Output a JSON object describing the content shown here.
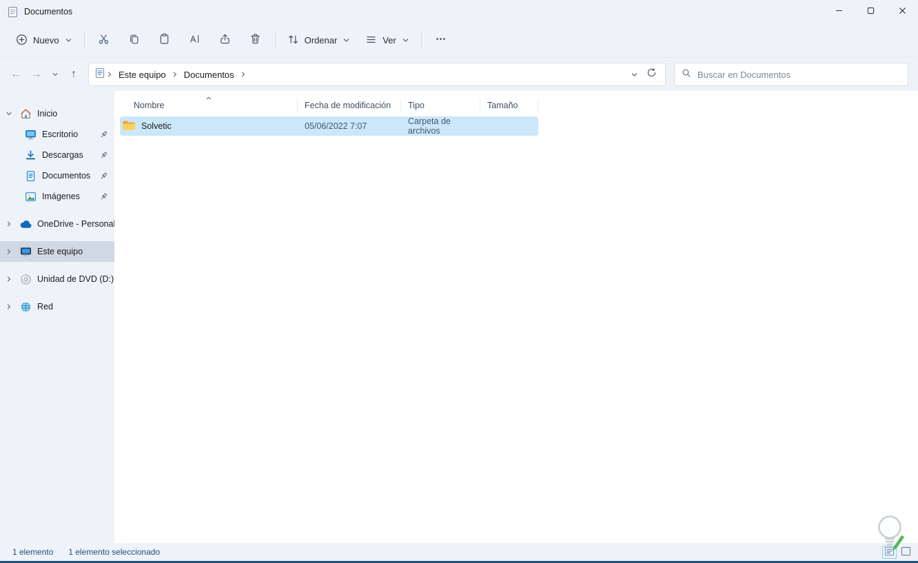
{
  "window": {
    "title": "Documentos"
  },
  "toolbar": {
    "new_label": "Nuevo",
    "sort_label": "Ordenar",
    "view_label": "Ver"
  },
  "navbar": {
    "breadcrumb": [
      "Este equipo",
      "Documentos"
    ],
    "search_placeholder": "Buscar en Documentos"
  },
  "icons": {
    "back": "←",
    "forward": "→",
    "up": "↑",
    "app": "document-icon",
    "new": "plus-circle-icon",
    "cut": "scissors-icon",
    "copy": "copy-icon",
    "paste": "clipboard-icon",
    "rename": "rename-icon",
    "share": "share-icon",
    "delete": "trash-icon",
    "sort": "sort-arrows-icon",
    "view": "list-lines-icon",
    "more": "ellipsis-icon",
    "refresh": "refresh-icon",
    "search": "magnifier-icon"
  },
  "sidebar": {
    "items": [
      {
        "label": "Inicio",
        "icon": "home-icon",
        "state": "expanded"
      },
      {
        "label": "Escritorio",
        "icon": "desktop-icon",
        "pinned": true
      },
      {
        "label": "Descargas",
        "icon": "downloads-icon",
        "pinned": true
      },
      {
        "label": "Documentos",
        "icon": "documents-icon",
        "pinned": true
      },
      {
        "label": "Imágenes",
        "icon": "pictures-icon",
        "pinned": true
      },
      {
        "label": "OneDrive - Personal",
        "icon": "onedrive-icon",
        "state": "collapsed"
      },
      {
        "label": "Este equipo",
        "icon": "computer-icon",
        "state": "collapsed",
        "selected": true
      },
      {
        "label": "Unidad de DVD (D:)",
        "icon": "dvd-icon",
        "state": "collapsed"
      },
      {
        "label": "Red",
        "icon": "network-icon",
        "state": "collapsed"
      }
    ]
  },
  "files": {
    "columns": [
      {
        "label": "Nombre",
        "sort": "ascending"
      },
      {
        "label": "Fecha de modificación"
      },
      {
        "label": "Tipo"
      },
      {
        "label": "Tamaño"
      }
    ],
    "rows": [
      {
        "name": "Solvetic",
        "icon": "folder-icon",
        "modified": "05/06/2022 7:07",
        "type": "Carpeta de archivos",
        "size": "",
        "selected": true
      }
    ]
  },
  "statusbar": {
    "items_count": "1 elemento",
    "selection_count": "1 elemento seleccionado"
  },
  "colors": {
    "chrome_background": "#eef3f9",
    "selection_fill": "#cbe7f9",
    "sidebar_selected": "#d0d9e3",
    "accent_blue": "#1c7fd6",
    "folder_yellow": "#ffd05c",
    "status_text": "#1e4e79",
    "bottom_edge": "#1f4e79"
  }
}
